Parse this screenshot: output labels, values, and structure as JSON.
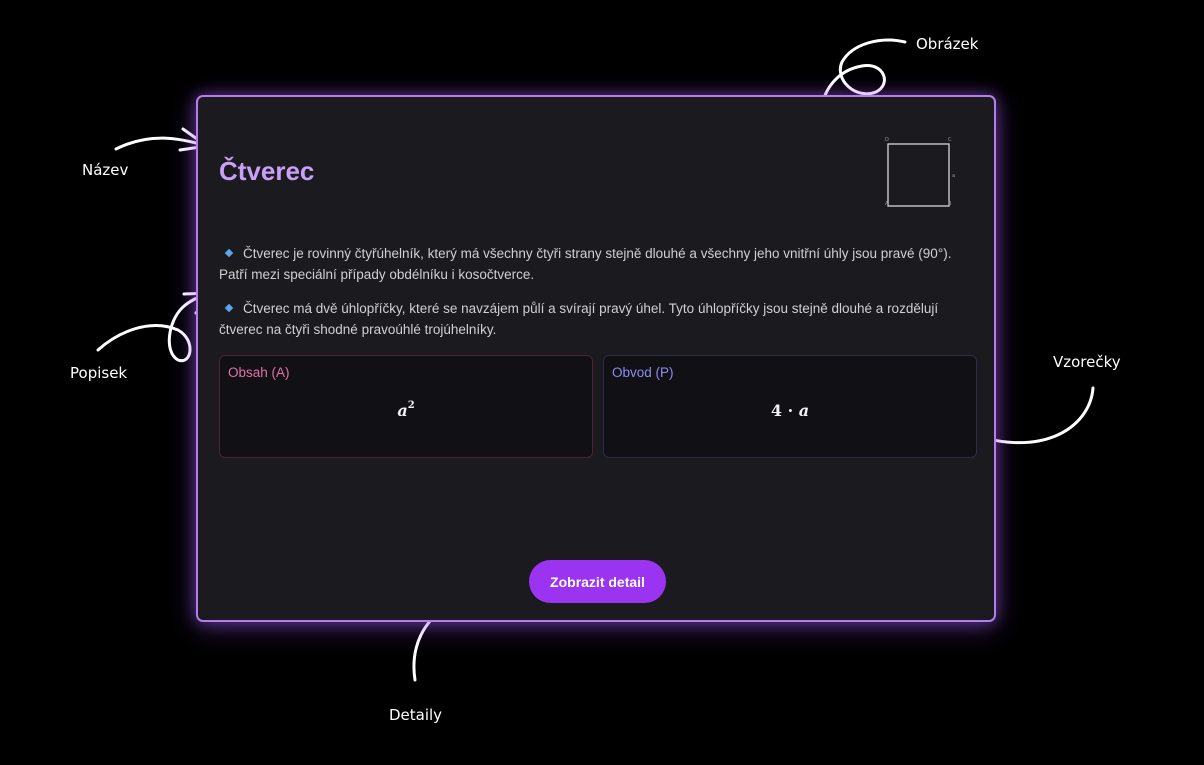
{
  "annotations": {
    "title": "Název",
    "description": "Popisek",
    "image": "Obrázek",
    "formulas": "Vzorečky",
    "details": "Detaily"
  },
  "card": {
    "title": "Čtverec",
    "image": {
      "icon": "square-diagram",
      "corner_labels": [
        "D",
        "C",
        "A",
        "B"
      ],
      "side_label": "a"
    },
    "descriptions": [
      "Čtverec je rovinný čtyřúhelník, který má všechny čtyři strany stejně dlouhé a všechny jeho vnitřní úhly jsou pravé (90°). Patří mezi speciální případy obdélníku i kosočtverce.",
      "Čtverec má dvě úhlopříčky, které se navzájem půlí a svírají pravý úhel. Tyto úhlopříčky jsou stejně dlouhé a rozdělují čtverec na čtyři shodné pravoúhlé trojúhelníky."
    ],
    "formulas": [
      {
        "label": "Obsah (A)",
        "base": "a",
        "exponent": "2"
      },
      {
        "label": "Obvod (P)",
        "number": "4",
        "operator": "·",
        "variable": "a"
      }
    ],
    "button_label": "Zobrazit detail"
  },
  "colors": {
    "accent": "#9b34f0",
    "title": "#c9a0f7",
    "border": "#b57cf0",
    "area_label": "#e272a8",
    "perimeter_label": "#8a8df0",
    "bullet": "#5aa4f0"
  }
}
